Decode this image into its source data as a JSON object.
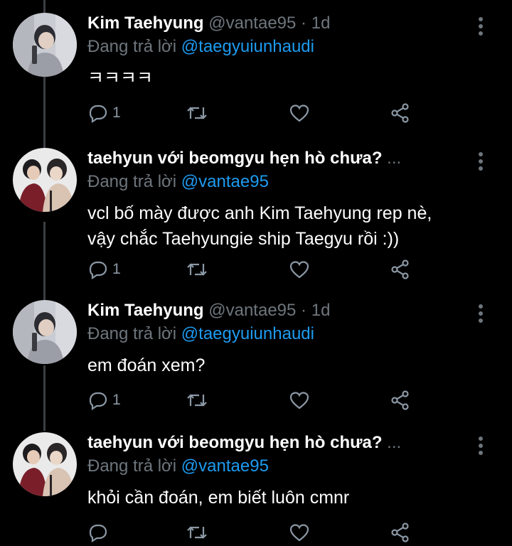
{
  "colors": {
    "background": "#000000",
    "name": "#ffffff",
    "muted": "#6e767d",
    "link": "#1d9bf0",
    "icon": "#8b98a5",
    "thread_line": "#3b3f44"
  },
  "tweets": [
    {
      "name": "Kim Taehyung",
      "handle": "@vantae95",
      "dot": "·",
      "time": "1d",
      "reply_prefix": "Đang trả lời",
      "reply_to": "@taegyuiunhaudi",
      "body": [
        "ㅋㅋㅋㅋ"
      ],
      "reply_count": "1",
      "avatar_icon": "profile-photo"
    },
    {
      "name": "taehyun với beomgyu hẹn hò chưa?",
      "handle": "",
      "ellipsis": "...",
      "reply_prefix": "Đang trả lời",
      "reply_to": "@vantae95",
      "body": [
        "vcl bố mày được anh Kim Taehyung rep nè,",
        "vậy chắc Taehyungie ship Taegyu rồi :))"
      ],
      "reply_count": "1",
      "avatar_icon": "profile-photo"
    },
    {
      "name": "Kim Taehyung",
      "handle": "@vantae95",
      "dot": "·",
      "time": "1d",
      "reply_prefix": "Đang trả lời",
      "reply_to": "@taegyuiunhaudi",
      "body": [
        "em đoán xem?"
      ],
      "reply_count": "1",
      "avatar_icon": "profile-photo"
    },
    {
      "name": "taehyun với beomgyu hẹn hò chưa?",
      "handle": "",
      "ellipsis": "...",
      "reply_prefix": "Đang trả lời",
      "reply_to": "@vantae95",
      "body": [
        "khỏi cần đoán, em biết luôn cmnr"
      ],
      "reply_count": "",
      "avatar_icon": "profile-photo"
    }
  ],
  "icons": {
    "reply": "reply-icon",
    "retweet": "retweet-icon",
    "like": "heart-icon",
    "share": "share-icon",
    "more": "more-vertical-icon"
  }
}
